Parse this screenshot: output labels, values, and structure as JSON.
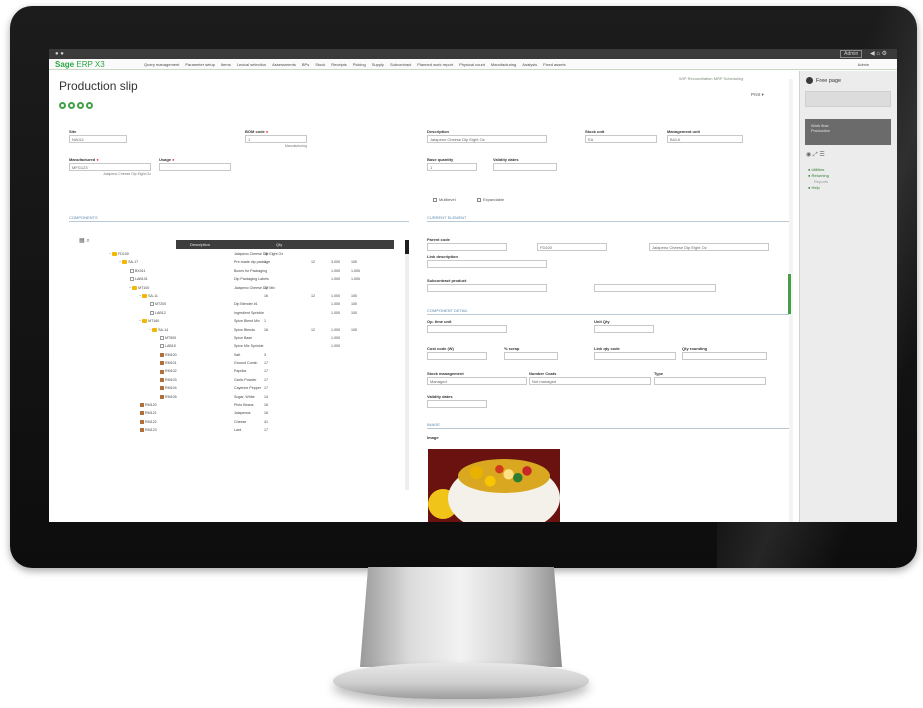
{
  "app": {
    "logo_brand": "Sage",
    "logo_product": "ERP X3"
  },
  "menu": {
    "items": [
      "Query management",
      "Parameter setup",
      "Items",
      "Lexical selection",
      "Assessments",
      "BPs",
      "Stock",
      "Receipts",
      "Picking",
      "Supply",
      "Subcontract",
      "Planned work report",
      "Physical count",
      "Manufacturing",
      "Analysis",
      "Fixed assets"
    ],
    "user": "Admin"
  },
  "titlebar": {
    "login_label": "Admin",
    "icons": [
      "back-icon",
      "home-icon",
      "settings-icon"
    ]
  },
  "page": {
    "title": "Production slip",
    "steps": 4,
    "top_links": "WIP Reconciliation   MRP Scheduling",
    "action_menu": "Print ▾"
  },
  "header_fields": [
    {
      "key": "site",
      "label": "Site",
      "value": "NA011"
    },
    {
      "key": "bom_code",
      "label": "BOM code",
      "value": "1"
    },
    {
      "key": "usage",
      "label": "Usage",
      "value": "Manufacturing"
    },
    {
      "key": "manufactured",
      "label": "Manufactured",
      "value": "MFG123"
    },
    {
      "key": "description",
      "label": "Description",
      "value": "Jalapeno Cheese Dip  Eight Oz"
    },
    {
      "key": "stock_unit",
      "label": "Stock unit",
      "value": "EA"
    },
    {
      "key": "management_unit",
      "label": "Management unit",
      "value": "BULK"
    },
    {
      "key": "base_quantity",
      "label": "Base quantity",
      "value": "1"
    },
    {
      "key": "validity_dates",
      "label": "Validity dates",
      "value": ""
    }
  ],
  "checks": {
    "multilevel": "Multilevel",
    "expandable": "Expandable"
  },
  "components": {
    "section_label": "COMPONENTS",
    "col_description": "Description",
    "col_qty": "Qty",
    "rows": [
      {
        "level": 0,
        "type": "folder",
        "code": "FD100",
        "desc": "Jalapeno Cheese Dip  Eight Oz",
        "qty": "16",
        "u1": "",
        "u2": "",
        "u3": ""
      },
      {
        "level": 1,
        "type": "folder",
        "code": "SA-17",
        "desc": "Pre-made dip package",
        "qty": "1",
        "u1": "12",
        "u2": "3.000",
        "u3": "100"
      },
      {
        "level": 2,
        "type": "item",
        "code": "BX011",
        "desc": "Boxes for Packaging",
        "qty": "",
        "u1": "",
        "u2": "1.000",
        "u3": "1.000"
      },
      {
        "level": 2,
        "type": "item",
        "code": "LAB101",
        "desc": "Dip Packaging Labels",
        "qty": "",
        "u1": "",
        "u2": "1.000",
        "u3": "1.000"
      },
      {
        "level": 2,
        "type": "folder",
        "code": "MT100",
        "desc": "Jalapeno Cheese Dip Mix",
        "qty": "17",
        "u1": "",
        "u2": "",
        "u3": ""
      },
      {
        "level": 3,
        "type": "folder",
        "code": "SA-11",
        "desc": "",
        "qty": "16",
        "u1": "12",
        "u2": "1.000",
        "u3": "100"
      },
      {
        "level": 4,
        "type": "item",
        "code": "MT200",
        "desc": "Dip Blender #1",
        "qty": "",
        "u1": "",
        "u2": "1.000",
        "u3": "100"
      },
      {
        "level": 4,
        "type": "item",
        "code": "LAB12",
        "desc": "Ingredient Sprinkle",
        "qty": "",
        "u1": "",
        "u2": "1.000",
        "u3": "100"
      },
      {
        "level": 3,
        "type": "folder",
        "code": "MT160",
        "desc": "Spice Blend Mix",
        "qty": "1",
        "u1": "",
        "u2": "",
        "u3": ""
      },
      {
        "level": 4,
        "type": "folder",
        "code": "SA-14",
        "desc": "Spice Blends",
        "qty": "16",
        "u1": "12",
        "u2": "1.000",
        "u3": "100"
      },
      {
        "level": 5,
        "type": "item",
        "code": "MT500",
        "desc": "Spice Base",
        "qty": "",
        "u1": "",
        "u2": "1.000",
        "u3": ""
      },
      {
        "level": 5,
        "type": "item",
        "code": "LAB15",
        "desc": "Spice Mix Sprinkle",
        "qty": "",
        "u1": "",
        "u2": "1.000",
        "u3": ""
      },
      {
        "level": 5,
        "type": "part",
        "code": "RM100",
        "desc": "Salt",
        "qty": "3",
        "u1": "",
        "u2": "",
        "u3": ""
      },
      {
        "level": 5,
        "type": "part",
        "code": "RM101",
        "desc": "Ground Cumin",
        "qty": "17",
        "u1": "",
        "u2": "",
        "u3": ""
      },
      {
        "level": 5,
        "type": "part",
        "code": "RM102",
        "desc": "Paprika",
        "qty": "17",
        "u1": "",
        "u2": "",
        "u3": ""
      },
      {
        "level": 5,
        "type": "part",
        "code": "RM103",
        "desc": "Garlic Powder",
        "qty": "17",
        "u1": "",
        "u2": "",
        "u3": ""
      },
      {
        "level": 5,
        "type": "part",
        "code": "RM104",
        "desc": "Cayenne Pepper",
        "qty": "17",
        "u1": "",
        "u2": "",
        "u3": ""
      },
      {
        "level": 5,
        "type": "part",
        "code": "RM105",
        "desc": "Sugar, White",
        "qty": "14",
        "u1": "",
        "u2": "",
        "u3": ""
      },
      {
        "level": 3,
        "type": "part",
        "code": "RM120",
        "desc": "Pinto Beans",
        "qty": "16",
        "u1": "",
        "u2": "",
        "u3": ""
      },
      {
        "level": 3,
        "type": "part",
        "code": "RM121",
        "desc": "Jalapenos",
        "qty": "16",
        "u1": "",
        "u2": "",
        "u3": ""
      },
      {
        "level": 3,
        "type": "part",
        "code": "RM122",
        "desc": "Cheese",
        "qty": "41",
        "u1": "",
        "u2": "",
        "u3": ""
      },
      {
        "level": 3,
        "type": "part",
        "code": "RM123",
        "desc": "Lard",
        "qty": "17",
        "u1": "",
        "u2": "",
        "u3": ""
      }
    ]
  },
  "current_element": {
    "section_label": "CURRENT ELEMENT",
    "parent_code_label": "Parent code",
    "parent_code": "FD100",
    "parent_desc": "Jalapeno Cheese Dip  Eight Oz",
    "link_description_label": "Link description",
    "subcontract_label": "Subcontract product"
  },
  "component_detail": {
    "section_label": "COMPONENT DETAIL",
    "lines": [
      {
        "label": "Op. time unit",
        "value": ""
      },
      {
        "label": "Unit Qty",
        "value": ""
      },
      {
        "label": "Cost code (W)",
        "value": ""
      },
      {
        "label": "% scrap",
        "value": ""
      },
      {
        "label": "Link qty code",
        "value": ""
      },
      {
        "label": "Qty rounding",
        "value": ""
      },
      {
        "label": "Stock management",
        "value": "Managed"
      },
      {
        "label": "Number Coats",
        "value": "Not managed"
      },
      {
        "label": "Type",
        "value": ""
      },
      {
        "label": "Validity dates",
        "value": ""
      }
    ]
  },
  "image_section": {
    "section_label": "IMAGE",
    "image_label": "Image"
  },
  "side_panel": {
    "title": "Free page",
    "box_label": "Work flow",
    "box_sub": "Production",
    "links": [
      "Utilities",
      "Returning",
      "Reports",
      "Help"
    ],
    "muted_link_index": 2
  },
  "colors": {
    "accent": "#43a047",
    "section_blue": "#5c8bb0",
    "dark_header": "#3d3d3d"
  }
}
